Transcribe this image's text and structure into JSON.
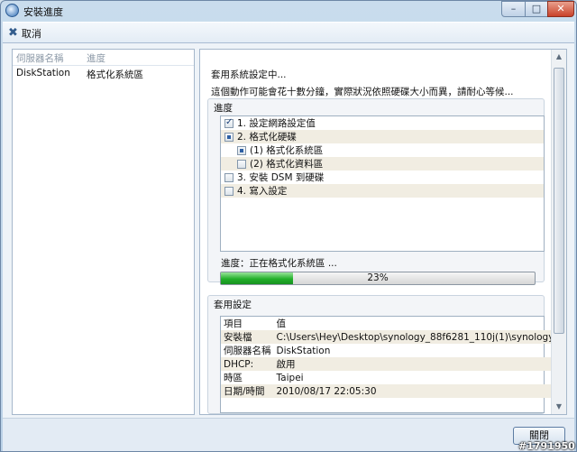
{
  "window": {
    "title": "安裝進度",
    "icon": "app-icon"
  },
  "toolbar": {
    "cancel_label": "取消",
    "cancel_icon": "tools-icon"
  },
  "server_list": {
    "headers": [
      "伺服器名稱",
      "進度"
    ],
    "rows": [
      {
        "name": "DiskStation",
        "status": "格式化系統區"
      }
    ]
  },
  "main": {
    "heading": "套用系統設定中...",
    "description": "這個動作可能會花十數分鐘，實際狀況依照硬碟大小而異，請耐心等候...",
    "progress_group": {
      "title": "進度",
      "tasks": [
        {
          "label": "1. 設定網路設定值",
          "state": "checked"
        },
        {
          "label": "2. 格式化硬碟",
          "state": "partial"
        },
        {
          "label": "(1) 格式化系統區",
          "state": "partial"
        },
        {
          "label": "(2) 格式化資料區",
          "state": "unchecked"
        },
        {
          "label": "3. 安裝 DSM 到硬碟",
          "state": "unchecked"
        },
        {
          "label": "4. 寫入設定",
          "state": "unchecked"
        }
      ],
      "status_text": "進度：正在格式化系統區 ...",
      "percent_label": "23%",
      "percent": 23
    },
    "settings_group": {
      "title": "套用設定",
      "headers": [
        "項目",
        "值"
      ],
      "rows": [
        {
          "item": "安裝檔",
          "value": "C:\\Users\\Hey\\Desktop\\synology_88f6281_110j(1)\\synology_"
        },
        {
          "item": "伺服器名稱",
          "value": "DiskStation"
        },
        {
          "item": "DHCP:",
          "value": "啟用"
        },
        {
          "item": "時區",
          "value": "Taipei"
        },
        {
          "item": "日期/時間",
          "value": "2010/08/17 22:05:30"
        }
      ]
    }
  },
  "footer": {
    "close_label": "關閉"
  },
  "watermark": "#1791950",
  "colors": {
    "progress": "#22b02a",
    "accent": "#2f6db3"
  }
}
